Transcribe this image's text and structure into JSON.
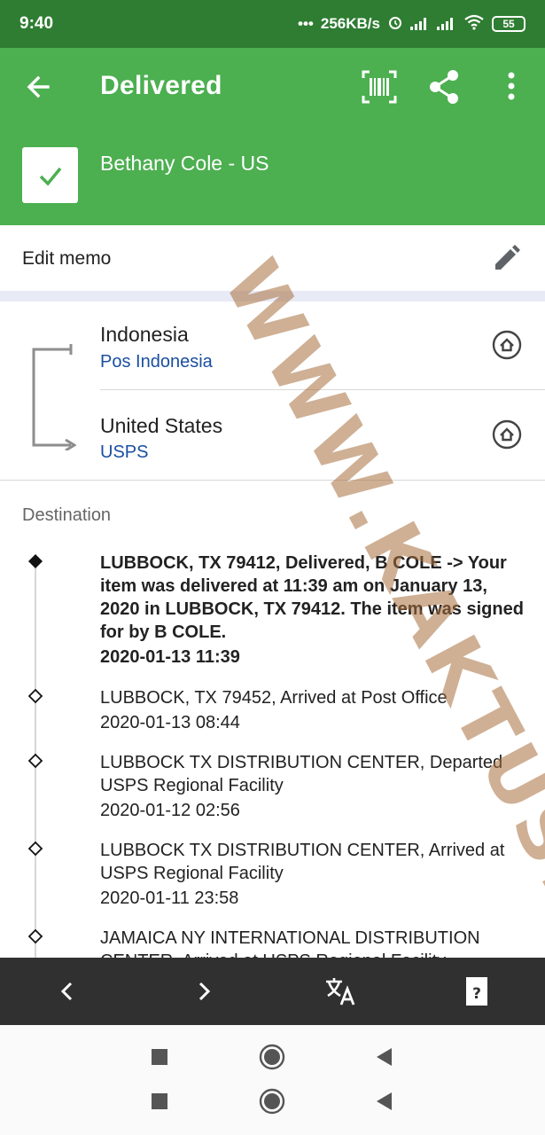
{
  "status_bar": {
    "time": "9:40",
    "network_speed": "256KB/s",
    "battery": "55",
    "icons": [
      "more-dots-icon",
      "alarm-icon",
      "signal-icon",
      "signal-icon",
      "wifi-icon",
      "battery-icon"
    ]
  },
  "app_bar": {
    "title": "Delivered",
    "recipient": "Bethany Cole - US",
    "icons": [
      "back-arrow-icon",
      "barcode-icon",
      "share-icon",
      "more-vert-icon",
      "checkmark-icon"
    ]
  },
  "memo": {
    "label": "Edit memo",
    "icon": "pencil-icon"
  },
  "route": {
    "origin": {
      "country": "Indonesia",
      "carrier": "Pos Indonesia"
    },
    "destination": {
      "country": "United States",
      "carrier": "USPS"
    },
    "icon": "home-icon"
  },
  "section_label": "Destination",
  "events": [
    {
      "text": "LUBBOCK, TX 79412, Delivered, B COLE -> Your item was delivered at 11:39 am on January 13, 2020 in LUBBOCK, TX 79412. The item was signed for by B COLE.",
      "time": "2020-01-13 11:39"
    },
    {
      "text": "LUBBOCK, TX 79452, Arrived at Post Office",
      "time": "2020-01-13 08:44"
    },
    {
      "text": "LUBBOCK TX DISTRIBUTION CENTER, Departed USPS Regional Facility",
      "time": "2020-01-12 02:56"
    },
    {
      "text": "LUBBOCK TX DISTRIBUTION CENTER, Arrived at USPS Regional Facility",
      "time": "2020-01-11 23:58"
    },
    {
      "text": "JAMAICA NY INTERNATIONAL DISTRIBUTION CENTER, Arrived at USPS Regional Facility",
      "time": ""
    }
  ],
  "bottom_toolbar": {
    "icons": [
      "chevron-left-icon",
      "chevron-right-icon",
      "translate-icon",
      "help-card-icon"
    ]
  },
  "system_nav": {
    "icons": [
      "recents-square-icon",
      "home-circle-icon",
      "back-triangle-icon"
    ]
  },
  "watermark": "WWW.KAKTUS.ID",
  "colors": {
    "status_bar": "#2e7d32",
    "app_bar": "#4caf50",
    "carrier_link": "#1a4fa0",
    "bottom_bar": "#303030",
    "watermark": "#a8703e"
  }
}
